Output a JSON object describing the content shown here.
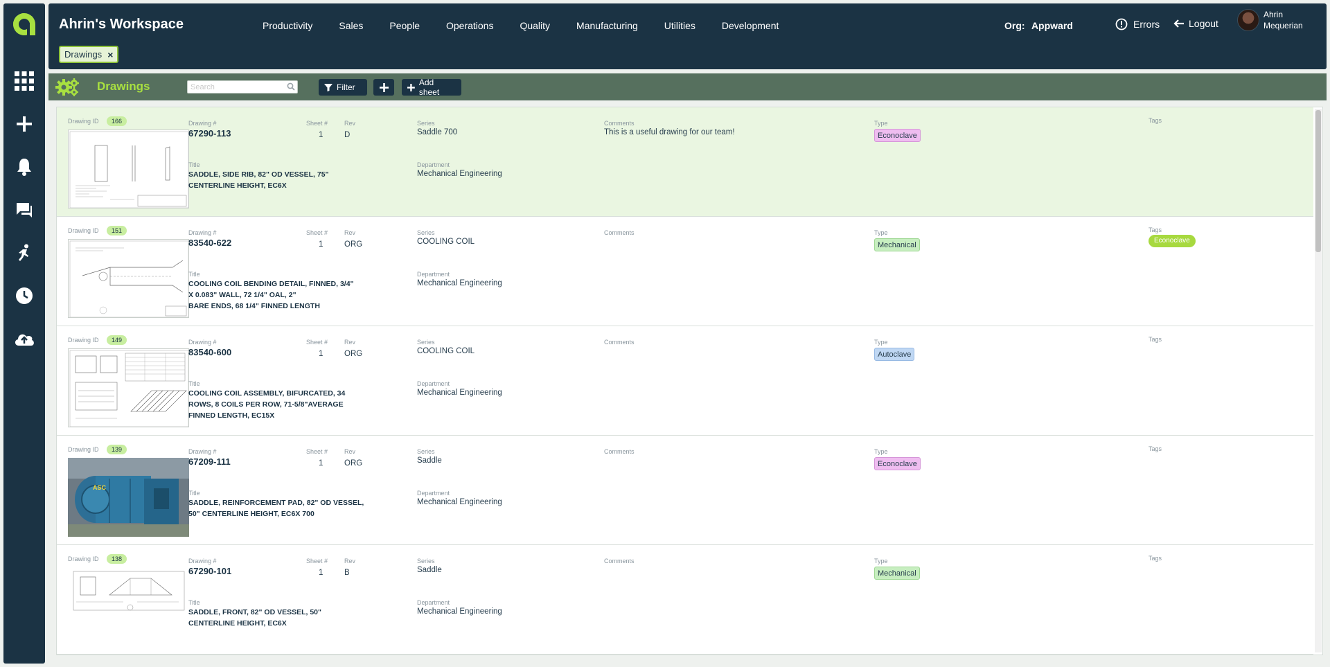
{
  "workspace_title": "Ahrin's Workspace",
  "nav": [
    "Productivity",
    "Sales",
    "People",
    "Operations",
    "Quality",
    "Manufacturing",
    "Utilities",
    "Development"
  ],
  "org": {
    "label": "Org:",
    "name": "Appward"
  },
  "errors_label": "Errors",
  "logout_label": "Logout",
  "user": {
    "first": "Ahrin",
    "last": "Mequerian"
  },
  "active_filter_chip": "Drawings",
  "toolbar": {
    "title": "Drawings",
    "search_placeholder": "Search",
    "filter_label": "Filter",
    "add_sheet_label": "Add sheet"
  },
  "labels": {
    "drawing_id": "Drawing ID",
    "drawing_num": "Drawing #",
    "sheet_num": "Sheet #",
    "rev": "Rev",
    "series": "Series",
    "comments": "Comments",
    "type": "Type",
    "tags": "Tags",
    "title": "Title",
    "department": "Department"
  },
  "rows": [
    {
      "id": "166",
      "drawing": "67290-113",
      "sheet": "1",
      "rev": "D",
      "series": "Saddle 700",
      "comments": "This is a useful drawing for our team!",
      "type": "Econoclave",
      "tag": "",
      "title": [
        "SADDLE, SIDE RIB, 82\" OD VESSEL, 75\"",
        "CENTERLINE HEIGHT, EC6X"
      ],
      "department": "Mechanical Engineering"
    },
    {
      "id": "151",
      "drawing": "83540-622",
      "sheet": "1",
      "rev": "ORG",
      "series": "COOLING COIL",
      "comments": "",
      "type": "Mechanical",
      "tag": "Econoclave",
      "title": [
        "COOLING COIL BENDING DETAIL, FINNED, 3/4\"",
        "X 0.083\" WALL, 72 1/4\" OAL, 2\"",
        "BARE ENDS, 68 1/4\" FINNED LENGTH"
      ],
      "department": "Mechanical Engineering"
    },
    {
      "id": "149",
      "drawing": "83540-600",
      "sheet": "1",
      "rev": "ORG",
      "series": "COOLING COIL",
      "comments": "",
      "type": "Autoclave",
      "tag": "",
      "title": [
        "COOLING COIL ASSEMBLY, BIFURCATED, 34",
        "ROWS, 8 COILS PER ROW, 71-5/8\"AVERAGE",
        "FINNED LENGTH, EC15X"
      ],
      "department": "Mechanical Engineering"
    },
    {
      "id": "139",
      "drawing": "67209-111",
      "sheet": "1",
      "rev": "ORG",
      "series": "Saddle",
      "comments": "",
      "type": "Econoclave",
      "tag": "",
      "title": [
        "SADDLE, REINFORCEMENT PAD, 82\" OD VESSEL,",
        "50\" CENTERLINE HEIGHT, EC6X 700"
      ],
      "department": "Mechanical Engineering"
    },
    {
      "id": "138",
      "drawing": "67290-101",
      "sheet": "1",
      "rev": "B",
      "series": "Saddle",
      "comments": "",
      "type": "Mechanical",
      "tag": "",
      "title": [
        "SADDLE, FRONT, 82\" OD VESSEL, 50\"",
        "CENTERLINE HEIGHT, EC6X"
      ],
      "department": "Mechanical Engineering"
    }
  ],
  "photo_thumb_text": "ASC",
  "colors": {
    "navy": "#1b3344",
    "accent_green": "#a8e040",
    "toolbar_green": "#56705e",
    "selected_row": "#eaf6e1"
  }
}
